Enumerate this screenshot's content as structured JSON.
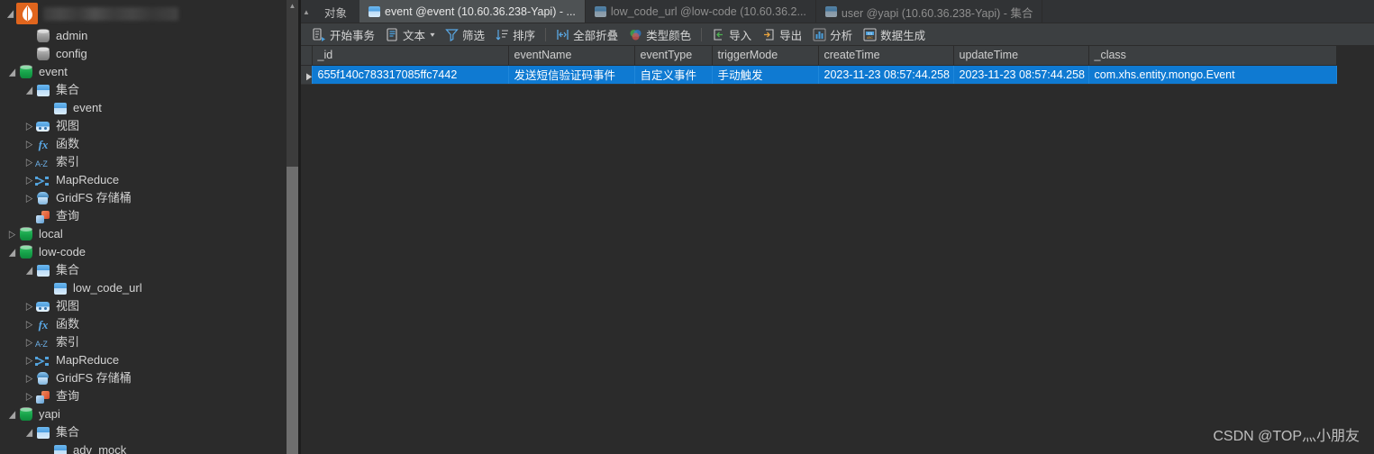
{
  "window": {
    "connection_label_redacted": "",
    "logo": "mongodb-leaf-logo"
  },
  "sidebar": {
    "nodes": [
      {
        "label": "admin",
        "icon": "database-gray-icon",
        "indent": 1,
        "expander": "none"
      },
      {
        "label": "config",
        "icon": "database-gray-icon",
        "indent": 1,
        "expander": "none"
      },
      {
        "label": "event",
        "icon": "database-icon",
        "indent": 0,
        "expander": "expanded"
      },
      {
        "label": "集合",
        "icon": "collection-folder-icon",
        "indent": 1,
        "expander": "expanded"
      },
      {
        "label": "event",
        "icon": "collection-icon",
        "indent": 2,
        "expander": "none"
      },
      {
        "label": "视图",
        "icon": "view-icon",
        "indent": 1,
        "expander": "collapsed"
      },
      {
        "label": "函数",
        "icon": "function-icon",
        "indent": 1,
        "expander": "collapsed"
      },
      {
        "label": "索引",
        "icon": "index-az-icon",
        "indent": 1,
        "expander": "collapsed"
      },
      {
        "label": "MapReduce",
        "icon": "mapreduce-icon",
        "indent": 1,
        "expander": "collapsed"
      },
      {
        "label": "GridFS 存储桶",
        "icon": "gridfs-icon",
        "indent": 1,
        "expander": "collapsed"
      },
      {
        "label": "查询",
        "icon": "query-icon",
        "indent": 1,
        "expander": "none"
      },
      {
        "label": "local",
        "icon": "database-icon",
        "indent": 0,
        "expander": "collapsed"
      },
      {
        "label": "low-code",
        "icon": "database-icon",
        "indent": 0,
        "expander": "expanded"
      },
      {
        "label": "集合",
        "icon": "collection-folder-icon",
        "indent": 1,
        "expander": "expanded"
      },
      {
        "label": "low_code_url",
        "icon": "collection-icon",
        "indent": 2,
        "expander": "none"
      },
      {
        "label": "视图",
        "icon": "view-icon",
        "indent": 1,
        "expander": "collapsed"
      },
      {
        "label": "函数",
        "icon": "function-icon",
        "indent": 1,
        "expander": "collapsed"
      },
      {
        "label": "索引",
        "icon": "index-az-icon",
        "indent": 1,
        "expander": "collapsed"
      },
      {
        "label": "MapReduce",
        "icon": "mapreduce-icon",
        "indent": 1,
        "expander": "collapsed"
      },
      {
        "label": "GridFS 存储桶",
        "icon": "gridfs-icon",
        "indent": 1,
        "expander": "collapsed"
      },
      {
        "label": "查询",
        "icon": "query-icon",
        "indent": 1,
        "expander": "collapsed"
      },
      {
        "label": "yapi",
        "icon": "database-icon",
        "indent": 0,
        "expander": "expanded"
      },
      {
        "label": "集合",
        "icon": "collection-folder-icon",
        "indent": 1,
        "expander": "expanded"
      },
      {
        "label": "adv_mock",
        "icon": "collection-icon",
        "indent": 2,
        "expander": "none"
      }
    ],
    "scrollbar": {
      "up_arrow": "▲"
    }
  },
  "tabbar": {
    "scroll_arrow": "▲",
    "static_label": "对象",
    "tabs": [
      {
        "label": "event @event (10.60.36.238-Yapi) - ...",
        "active": true
      },
      {
        "label": "low_code_url @low-code (10.60.36.2...",
        "active": false
      },
      {
        "label": "user @yapi (10.60.36.238-Yapi) - 集合",
        "active": false
      }
    ]
  },
  "toolbar": {
    "items": [
      {
        "label": "开始事务",
        "icon": "transaction-icon",
        "caret": false
      },
      {
        "label": "文本",
        "icon": "text-document-icon",
        "caret": true
      },
      {
        "label": "筛选",
        "icon": "filter-funnel-icon",
        "caret": false
      },
      {
        "label": "排序",
        "icon": "sort-icon",
        "caret": false
      },
      {
        "label": "全部折叠",
        "icon": "collapse-all-icon",
        "caret": false
      },
      {
        "label": "类型颜色",
        "icon": "type-color-icon",
        "caret": false
      },
      {
        "label": "导入",
        "icon": "import-icon",
        "caret": false
      },
      {
        "label": "导出",
        "icon": "export-icon",
        "caret": false
      },
      {
        "label": "分析",
        "icon": "analyze-chart-icon",
        "caret": false
      },
      {
        "label": "数据生成",
        "icon": "data-generation-icon",
        "caret": false
      }
    ]
  },
  "table": {
    "columns": [
      "_id",
      "eventName",
      "eventType",
      "triggerMode",
      "createTime",
      "updateTime",
      "_class"
    ],
    "rows": [
      {
        "selected": true,
        "expander": "▶",
        "cells": [
          "655f140c783317085ffc7442",
          "发送短信验证码事件",
          "自定义事件",
          "手动触发",
          "2023-11-23 08:57:44.258",
          "2023-11-23 08:57:44.258",
          "com.xhs.entity.mongo.Event"
        ]
      }
    ]
  },
  "watermark": {
    "text": "CSDN @TOP灬小朋友"
  },
  "colors": {
    "selection_blue": "#0f7ad2",
    "panel_gray": "#3c3f41",
    "background": "#2b2b2b",
    "tab_active": "#4e5254",
    "accent_orange": "#e0651d",
    "db_green": "#16a34a"
  }
}
